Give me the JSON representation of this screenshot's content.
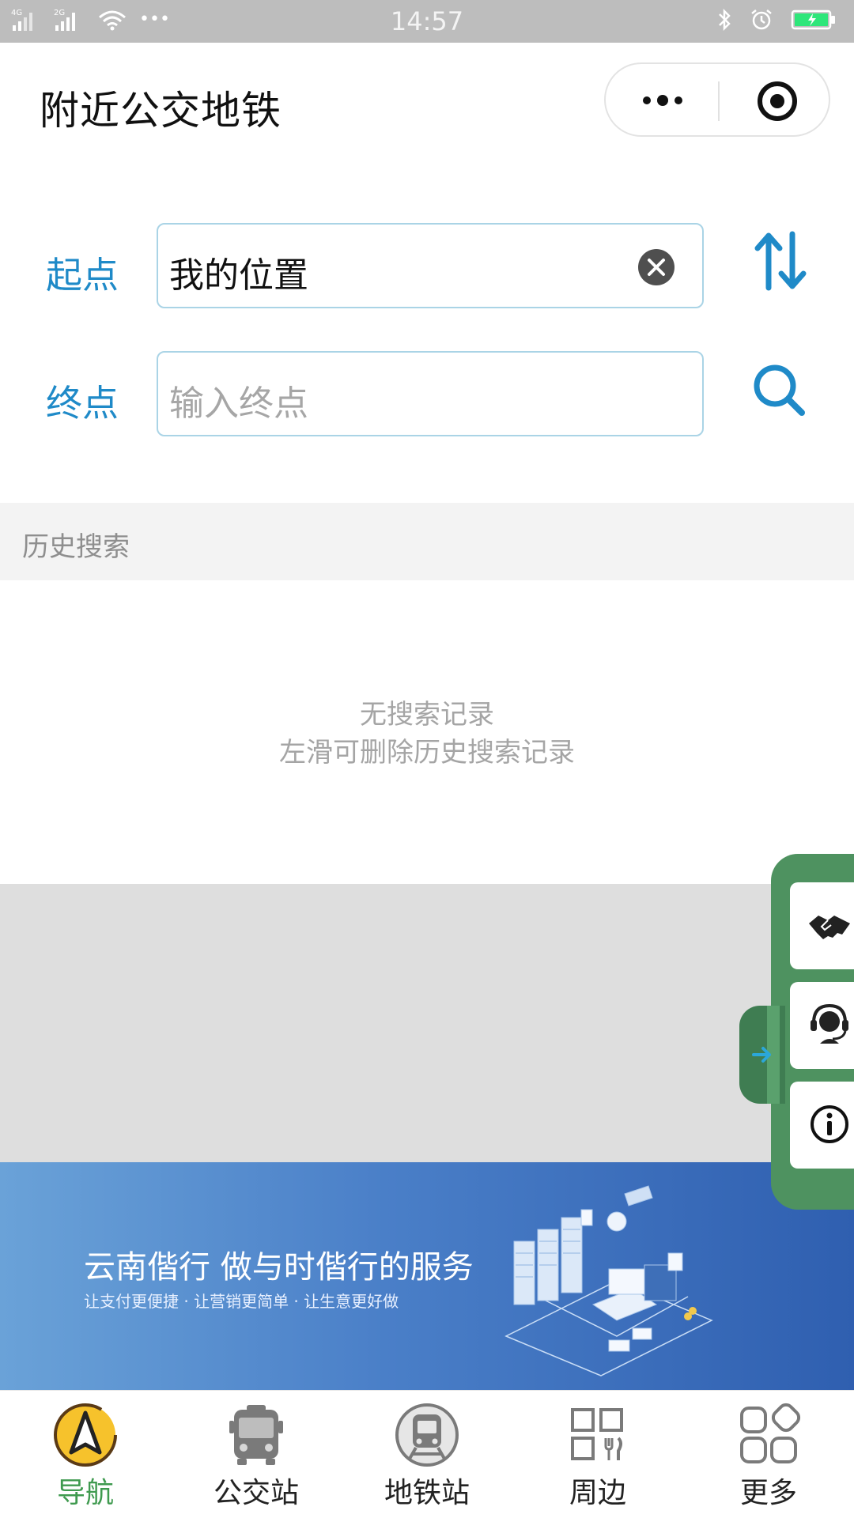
{
  "status_bar": {
    "time": "14:57",
    "network_1": "4G",
    "network_2": "2G",
    "dots": "•••"
  },
  "header": {
    "title": "附近公交地铁"
  },
  "route_form": {
    "start_label": "起点",
    "start_value": "我的位置",
    "end_label": "终点",
    "end_placeholder": "输入终点"
  },
  "history": {
    "title": "历史搜索",
    "empty_line1": "无搜索记录",
    "empty_line2": "左滑可删除历史搜索记录"
  },
  "banner": {
    "headline": "云南偕行  做与时偕行的服务",
    "subline": "让支付更便捷 · 让营销更简单 · 让生意更好做"
  },
  "tabs": [
    {
      "label": "导航",
      "icon": "navigation-icon",
      "active": true
    },
    {
      "label": "公交站",
      "icon": "bus-icon",
      "active": false
    },
    {
      "label": "地铁站",
      "icon": "subway-icon",
      "active": false
    },
    {
      "label": "周边",
      "icon": "nearby-icon",
      "active": false
    },
    {
      "label": "更多",
      "icon": "more-grid-icon",
      "active": false
    }
  ],
  "colors": {
    "accent_blue": "#1f8ac8",
    "active_green": "#3f9a4f",
    "panel_green": "#4e9260",
    "status_bar": "#bdbdbd"
  }
}
